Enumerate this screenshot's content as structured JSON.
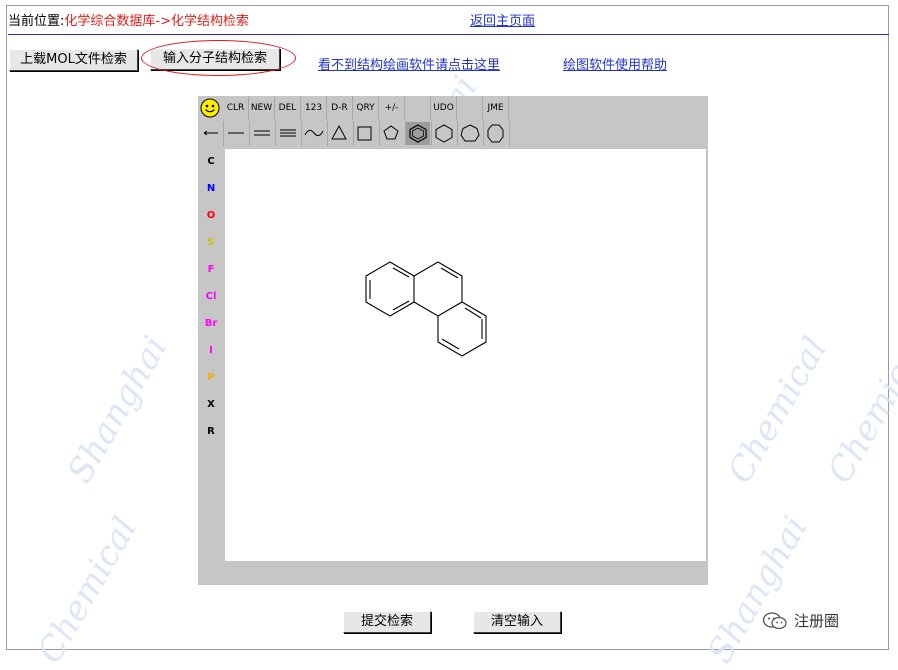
{
  "location": {
    "label": "当前位置:",
    "path": "化学综合数据库->化学结构检索"
  },
  "home_link": "返回主页面",
  "buttons": {
    "upload": "上载MOL文件检索",
    "draw": "输入分子结构检索",
    "submit": "提交检索",
    "clear": "清空输入"
  },
  "links": {
    "no_software": "看不到结构绘画软件请点击这里",
    "help": "绘图软件使用帮助"
  },
  "jme": {
    "row1": [
      "CLR",
      "NEW",
      "DEL",
      "123",
      "D-R",
      "QRY",
      "+/-",
      "",
      "UDO",
      "",
      "JME"
    ],
    "atoms": [
      {
        "label": "C",
        "color": "#000000"
      },
      {
        "label": "N",
        "color": "#0000ff"
      },
      {
        "label": "O",
        "color": "#ff0000"
      },
      {
        "label": "S",
        "color": "#c8c800"
      },
      {
        "label": "F",
        "color": "#ff00ff"
      },
      {
        "label": "Cl",
        "color": "#ff00ff"
      },
      {
        "label": "Br",
        "color": "#ff00ff"
      },
      {
        "label": "I",
        "color": "#ff00ff"
      },
      {
        "label": "P",
        "color": "#ffaa00"
      },
      {
        "label": "X",
        "color": "#000000"
      },
      {
        "label": "R",
        "color": "#000000"
      }
    ]
  },
  "badge": "注册圈",
  "watermarks": [
    "Shanghai",
    "Chemical",
    "Shanghai",
    "Chemical",
    "Shanghai",
    "Chemical"
  ]
}
